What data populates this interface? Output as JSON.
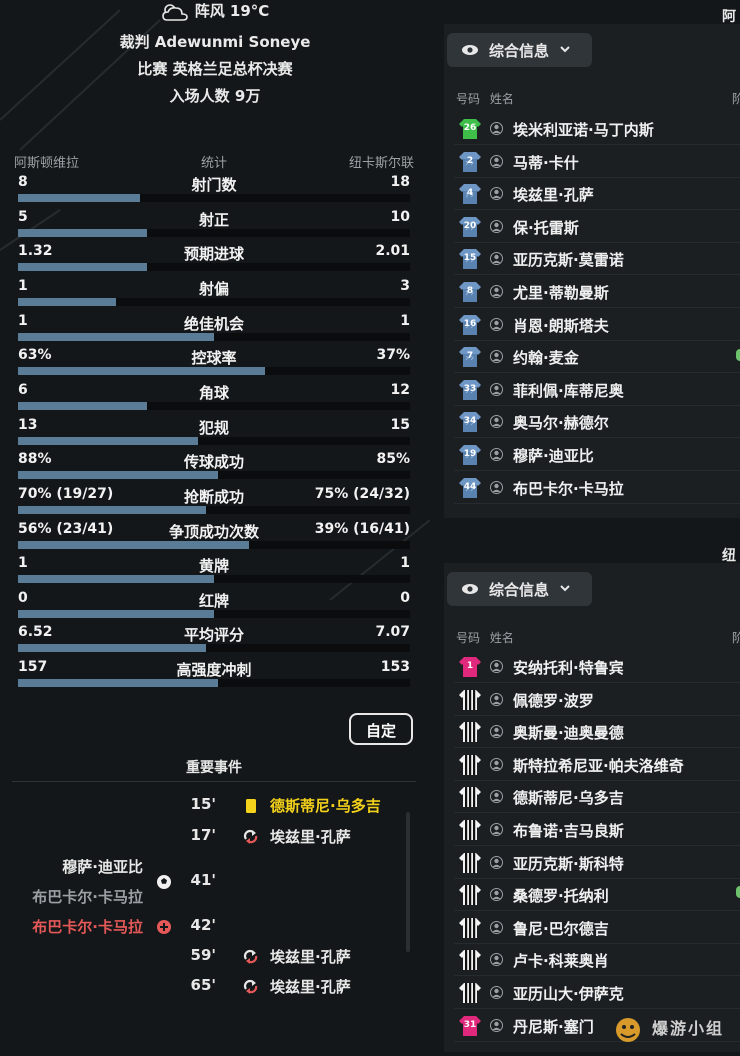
{
  "header": {
    "weather": "阵风 19°C",
    "referee": "裁判 Adewunmi Soneye",
    "competition": "比赛 英格兰足总杯决赛",
    "attendance": "入场人数 9万"
  },
  "stats": {
    "home_team": "阿斯顿维拉",
    "title": "统计",
    "away_team": "纽卡斯尔联",
    "rows": [
      {
        "name": "射门数",
        "home": "8",
        "away": "18",
        "home_share": 0.31
      },
      {
        "name": "射正",
        "home": "5",
        "away": "10",
        "home_share": 0.33
      },
      {
        "name": "预期进球",
        "home": "1.32",
        "away": "2.01",
        "home_share": 0.33
      },
      {
        "name": "射偏",
        "home": "1",
        "away": "3",
        "home_share": 0.25
      },
      {
        "name": "绝佳机会",
        "home": "1",
        "away": "1",
        "home_share": 0.5
      },
      {
        "name": "控球率",
        "home": "63%",
        "away": "37%",
        "home_share": 0.63
      },
      {
        "name": "角球",
        "home": "6",
        "away": "12",
        "home_share": 0.33
      },
      {
        "name": "犯规",
        "home": "13",
        "away": "15",
        "home_share": 0.46
      },
      {
        "name": "传球成功",
        "home": "88%",
        "away": "85%",
        "home_share": 0.51
      },
      {
        "name": "抢断成功",
        "home": "70% (19/27)",
        "away": "75% (24/32)",
        "home_share": 0.48
      },
      {
        "name": "争顶成功次数",
        "home": "56% (23/41)",
        "away": "39% (16/41)",
        "home_share": 0.59
      },
      {
        "name": "黄牌",
        "home": "1",
        "away": "1",
        "home_share": 0.5
      },
      {
        "name": "红牌",
        "home": "0",
        "away": "0",
        "home_share": 0.5
      },
      {
        "name": "平均评分",
        "home": "6.52",
        "away": "7.07",
        "home_share": 0.48
      },
      {
        "name": "高强度冲刺",
        "home": "157",
        "away": "153",
        "home_share": 0.51
      }
    ]
  },
  "custom_button": "自定",
  "events": {
    "title": "重要事件",
    "items": [
      {
        "minute": "15'",
        "name": "德斯蒂尼·乌多吉",
        "side": "away",
        "type": "yellow-card"
      },
      {
        "minute": "17'",
        "name": "埃兹里·孔萨",
        "side": "away",
        "type": "substitution"
      },
      {
        "minute": "41'",
        "name": "穆萨·迪亚比",
        "assist": "布巴卡尔·卡马拉",
        "side": "home",
        "type": "goal"
      },
      {
        "minute": "42'",
        "name": "布巴卡尔·卡马拉",
        "side": "home",
        "type": "injury"
      },
      {
        "minute": "59'",
        "name": "埃兹里·孔萨",
        "side": "away",
        "type": "substitution"
      },
      {
        "minute": "65'",
        "name": "埃兹里·孔萨",
        "side": "away",
        "type": "substitution"
      }
    ]
  },
  "panel_top": {
    "team_label": "阿斯",
    "dropdown": "综合信息",
    "col_number": "号码",
    "col_name": "姓名",
    "col_extra": "阶",
    "players": [
      {
        "number": "26",
        "name": "埃米利亚诺·马丁内斯",
        "kit": "gk-green"
      },
      {
        "number": "2",
        "name": "马蒂·卡什",
        "kit": "villa"
      },
      {
        "number": "4",
        "name": "埃兹里·孔萨",
        "kit": "villa"
      },
      {
        "number": "20",
        "name": "保·托雷斯",
        "kit": "villa"
      },
      {
        "number": "15",
        "name": "亚历克斯·莫雷诺",
        "kit": "villa"
      },
      {
        "number": "8",
        "name": "尤里·蒂勒曼斯",
        "kit": "villa"
      },
      {
        "number": "16",
        "name": "肖恩·朗斯塔夫",
        "kit": "villa"
      },
      {
        "number": "7",
        "name": "约翰·麦金",
        "kit": "villa"
      },
      {
        "number": "33",
        "name": "菲利佩·库蒂尼奥",
        "kit": "villa"
      },
      {
        "number": "34",
        "name": "奥马尔·赫德尔",
        "kit": "villa"
      },
      {
        "number": "19",
        "name": "穆萨·迪亚比",
        "kit": "villa"
      },
      {
        "number": "44",
        "name": "布巴卡尔·卡马拉",
        "kit": "villa"
      }
    ]
  },
  "panel_bottom": {
    "team_label": "纽",
    "dropdown": "综合信息",
    "col_number": "号码",
    "col_name": "姓名",
    "col_extra": "阶",
    "players": [
      {
        "number": "1",
        "name": "安纳托利·特鲁宾",
        "kit": "gk-pink"
      },
      {
        "number": "",
        "name": "佩德罗·波罗",
        "kit": "newcastle"
      },
      {
        "number": "",
        "name": "奥斯曼·迪奥曼德",
        "kit": "newcastle"
      },
      {
        "number": "",
        "name": "斯特拉希尼亚·帕夫洛维奇",
        "kit": "newcastle"
      },
      {
        "number": "",
        "name": "德斯蒂尼·乌多吉",
        "kit": "newcastle"
      },
      {
        "number": "",
        "name": "布鲁诺·吉马良斯",
        "kit": "newcastle"
      },
      {
        "number": "",
        "name": "亚历克斯·斯科特",
        "kit": "newcastle"
      },
      {
        "number": "",
        "name": "桑德罗·托纳利",
        "kit": "newcastle"
      },
      {
        "number": "",
        "name": "鲁尼·巴尔德吉",
        "kit": "newcastle"
      },
      {
        "number": "",
        "name": "卢卡·科莱奥肖",
        "kit": "newcastle"
      },
      {
        "number": "",
        "name": "亚历山大·伊萨克",
        "kit": "newcastle"
      },
      {
        "number": "31",
        "name": "丹尼斯·塞门",
        "kit": "gk-pink"
      }
    ]
  },
  "watermark": "爆游小组"
}
